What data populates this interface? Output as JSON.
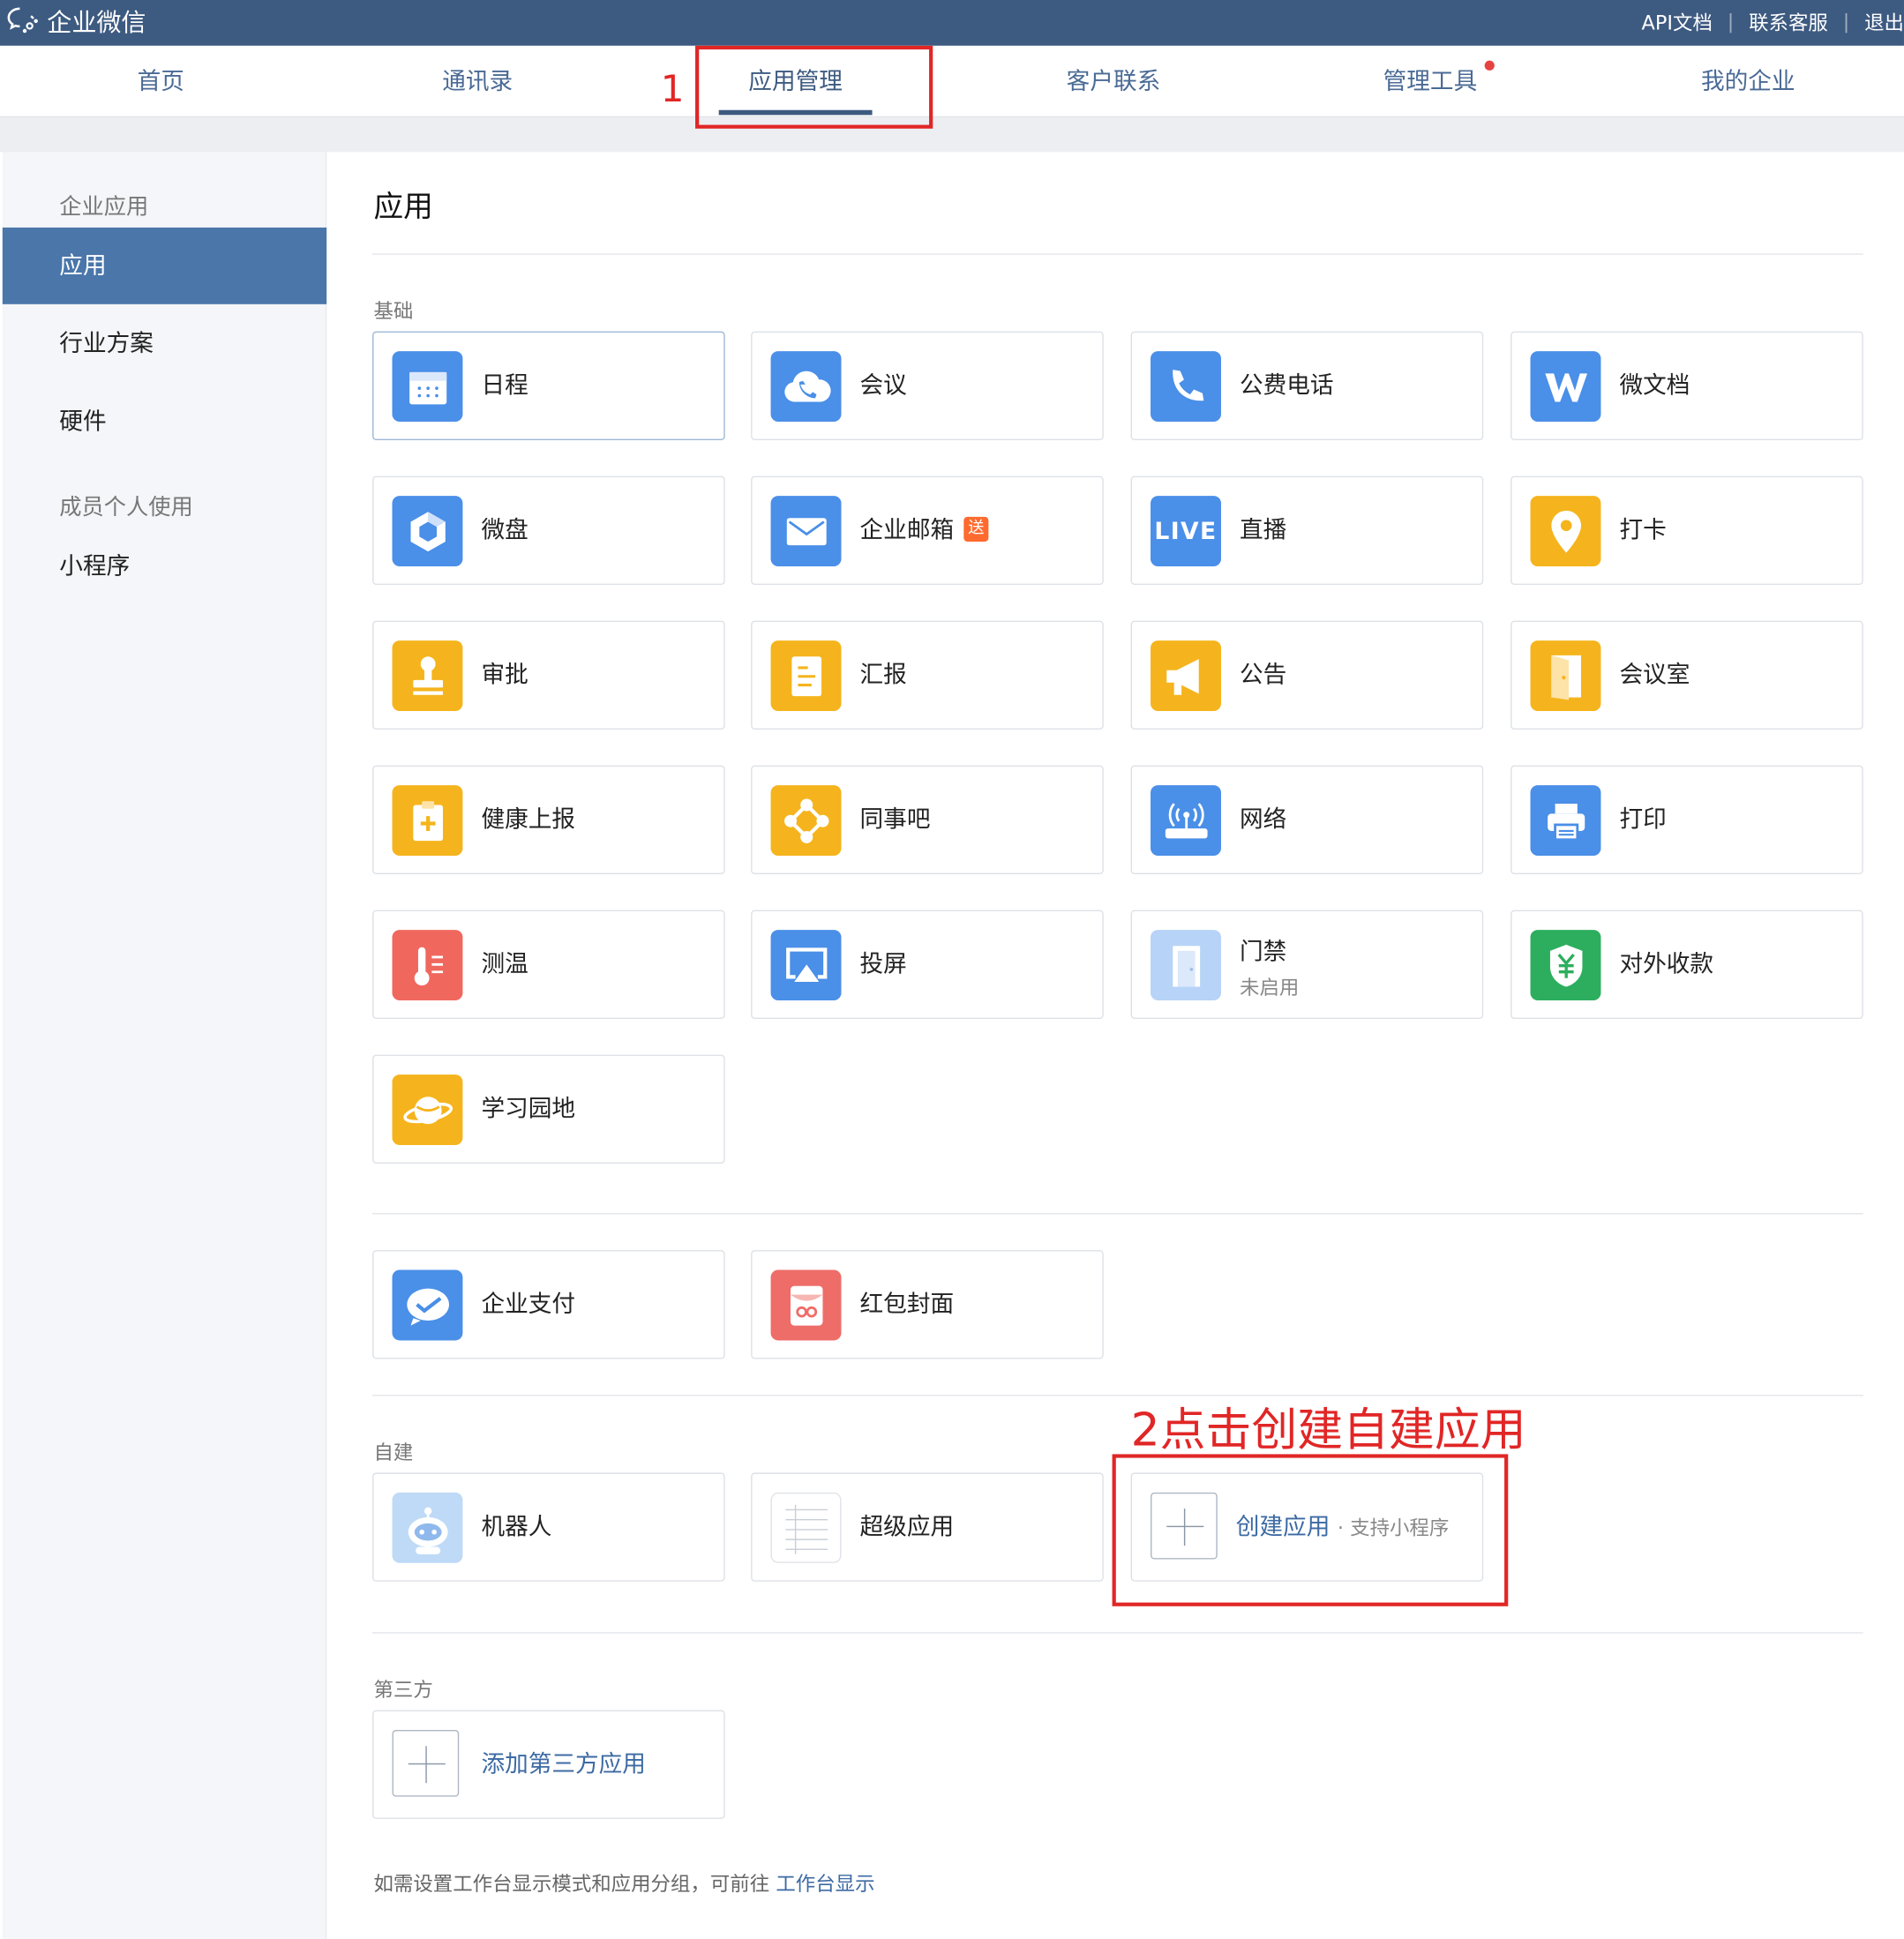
{
  "app": {
    "logo_text": "企业微信"
  },
  "top_links": [
    "API文档",
    "联系客服",
    "退出"
  ],
  "nav": {
    "items": [
      "首页",
      "通讯录",
      "应用管理",
      "客户联系",
      "管理工具",
      "我的企业"
    ],
    "active": "应用管理"
  },
  "sidebar": {
    "group1": "企业应用",
    "items1": [
      "应用",
      "行业方案",
      "硬件"
    ],
    "group2": "成员个人使用",
    "items2": [
      "小程序"
    ]
  },
  "page": {
    "title": "应用",
    "sections": {
      "basic": "基础",
      "self_built": "自建",
      "third_party": "第三方"
    }
  },
  "basic_apps": [
    {
      "name": "日程",
      "icon": "calendar-icon",
      "color": "#4a8fe8"
    },
    {
      "name": "会议",
      "icon": "cloud-phone-icon",
      "color": "#4a8fe8"
    },
    {
      "name": "公费电话",
      "icon": "phone-icon",
      "color": "#4a8fe8"
    },
    {
      "name": "微文档",
      "icon": "w-doc-icon",
      "color": "#4a8fe8"
    },
    {
      "name": "微盘",
      "icon": "drive-icon",
      "color": "#4a8fe8"
    },
    {
      "name": "企业邮箱",
      "icon": "mail-icon",
      "color": "#4a8fe8",
      "badge": "送"
    },
    {
      "name": "直播",
      "icon": "live-icon",
      "color": "#4a8fe8",
      "icon_text": "LIVE"
    },
    {
      "name": "打卡",
      "icon": "location-pin-icon",
      "color": "#f5b41d"
    },
    {
      "name": "审批",
      "icon": "stamp-icon",
      "color": "#f5b41d"
    },
    {
      "name": "汇报",
      "icon": "report-icon",
      "color": "#f5b41d"
    },
    {
      "name": "公告",
      "icon": "megaphone-icon",
      "color": "#f5b41d"
    },
    {
      "name": "会议室",
      "icon": "door-icon",
      "color": "#f5b41d"
    },
    {
      "name": "健康上报",
      "icon": "health-clipboard-icon",
      "color": "#f5b41d"
    },
    {
      "name": "同事吧",
      "icon": "network-icon",
      "color": "#f5b41d"
    },
    {
      "name": "网络",
      "icon": "router-icon",
      "color": "#4a8fe8"
    },
    {
      "name": "打印",
      "icon": "printer-icon",
      "color": "#4a8fe8"
    },
    {
      "name": "测温",
      "icon": "thermometer-icon",
      "color": "#f0675e"
    },
    {
      "name": "投屏",
      "icon": "screencast-icon",
      "color": "#4a8fe8"
    },
    {
      "name": "门禁",
      "icon": "access-door-icon",
      "color": "#b7d3f7",
      "sub": "未启用"
    },
    {
      "name": "对外收款",
      "icon": "yuan-shield-icon",
      "color": "#2dae5e"
    },
    {
      "name": "学习园地",
      "icon": "planet-icon",
      "color": "#f5b41d"
    }
  ],
  "pay_apps": [
    {
      "name": "企业支付",
      "icon": "pay-check-icon",
      "color": "#4a8fe8"
    },
    {
      "name": "红包封面",
      "icon": "red-envelope-icon",
      "color": "#ee6d68"
    }
  ],
  "self_built": {
    "apps": [
      {
        "name": "机器人",
        "icon": "robot-icon"
      },
      {
        "name": "超级应用",
        "icon": "super-app-icon"
      }
    ],
    "create_label": "创建应用",
    "create_extra": "· 支持小程序"
  },
  "third_party": {
    "add_label": "添加第三方应用"
  },
  "footer": {
    "note": "如需设置工作台显示模式和应用分组，可前往",
    "link": "工作台显示"
  },
  "annotations": {
    "step1": "1",
    "step2": "2点击创建自建应用"
  }
}
